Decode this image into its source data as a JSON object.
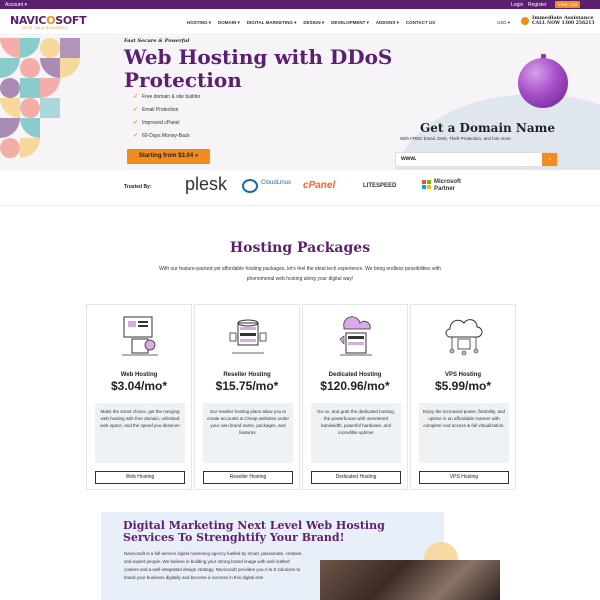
{
  "topbar": {
    "account": "Account ▾",
    "login": "Login",
    "register": "Register",
    "cart": "View Cart"
  },
  "header": {
    "logo": "NAVICOSOFT",
    "tagline": "LETS TALK BUSINESS",
    "nav": [
      "HOSTING ▾",
      "DOMAIN ▾",
      "DIGITAL MARKETING ▾",
      "DESIGN ▾",
      "DEVELOPMENT ▾",
      "ADDONS ▾",
      "CONTACT US"
    ],
    "currency": "USD ▾",
    "assist_title": "Immediate Assistance",
    "assist_phone": "CALL NOW 1300 256213"
  },
  "hero": {
    "kicker": "Fast Secure & Powerful",
    "title": "Web Hosting with DDoS Protection",
    "features": [
      "Free domain & site builder",
      "Email Protection",
      "Improved cPanel",
      "60-Days Money-Back"
    ],
    "cta": "Starting from $3.04 »"
  },
  "domain": {
    "title": "Get a Domain Name",
    "subtitle": "With FREE Email, DNS, Theft Protection, and lots more",
    "input_value": "www."
  },
  "trusted": {
    "label": "Trusted By:",
    "logos": [
      "plesk",
      "CloudLinux",
      "cPanel",
      "LITESPEED",
      "Microsoft Partner"
    ]
  },
  "packages": {
    "title": "Hosting Packages",
    "description": "With our feature-packed yet affordable hosting packages, let's feel the ideal tech experience. We bring endless possibilities with phenomenal web hosting along your digital way!",
    "cards": [
      {
        "name": "Web Hosting",
        "price": "$3.04/mo*",
        "text": "Make the smart choice, get the merging web hosting with free domain, unlimited web space, and the speed you deserve!",
        "button": "Web Hosting"
      },
      {
        "name": "Reseller Hosting",
        "price": "$15.75/mo*",
        "text": "Our reseller hosting plans allow you to create accounts & Cheap websites under your own brand name, packages, and features.",
        "button": "Reseller Hosting"
      },
      {
        "name": "Dedicated Hosting",
        "price": "$120.96/mo*",
        "text": "Go on, and grab the dedicated hosting, the powerhouse with unmetered bandwidth, powerful hardware, and incredible uptime!",
        "button": "Dedicated Hosting"
      },
      {
        "name": "VPS Hosting",
        "price": "$5.99/mo*",
        "text": "Enjoy the increased power, flexibility, and uptime in an affordable manner with complete root access & full virtualization.",
        "button": "VPS Hosting"
      }
    ]
  },
  "marketing": {
    "title": "Digital Marketing Next Level Web Hosting Services To Strenghtify Your Brand!",
    "text_before": "Navicosoft is a full-service ",
    "text_link": "digital marketing agency",
    "text_after": " fuelled by smart, passionate, creative, and expert people. We believe in building your strong brand image with well crafted content and a well-integrated design strategy. Navicosoft provides you A to Z solutions to brand your business digitally and become a success in this digital era!"
  },
  "colors": {
    "brand": "#5a1f6e",
    "accent": "#f28c1f"
  }
}
